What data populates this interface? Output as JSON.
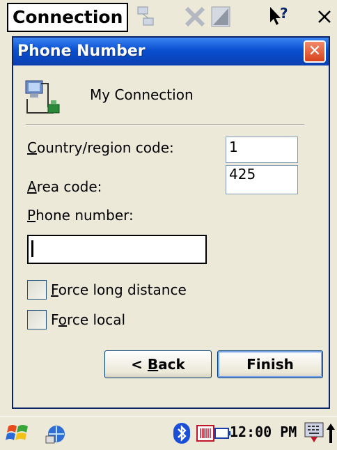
{
  "toolbar": {
    "connection_label": "Connection"
  },
  "dialog": {
    "title": "Phone Number",
    "close_icon": "close-icon",
    "connection_name": "My Connection",
    "country_code_label_prefix": "",
    "country_code_label_key": "C",
    "country_code_label_rest": "ountry/region code:",
    "country_code_value": "1",
    "area_code_label_key": "A",
    "area_code_label_rest": "rea code:",
    "area_code_value": "425",
    "phone_number_label_key": "P",
    "phone_number_label_rest": "hone number:",
    "phone_number_value": "",
    "force_long_distance_key": "F",
    "force_long_distance_rest": "orce long distance",
    "force_long_distance_checked": false,
    "force_local_pre": "F",
    "force_local_key": "o",
    "force_local_rest": "rce local",
    "force_local_checked": false,
    "back_pre": "< ",
    "back_key": "B",
    "back_rest": "ack",
    "finish_label": "Finish"
  },
  "taskbar": {
    "clock": "12:00 PM",
    "icons": [
      "start-icon",
      "network-icon",
      "bluetooth-icon",
      "barcode-icon",
      "battery-icon",
      "keyboard-icon",
      "up-arrow-icon"
    ]
  },
  "colors": {
    "titlebar": "#0a4fd0",
    "window_bg": "#ece9d8",
    "close_button": "#d8421c"
  }
}
